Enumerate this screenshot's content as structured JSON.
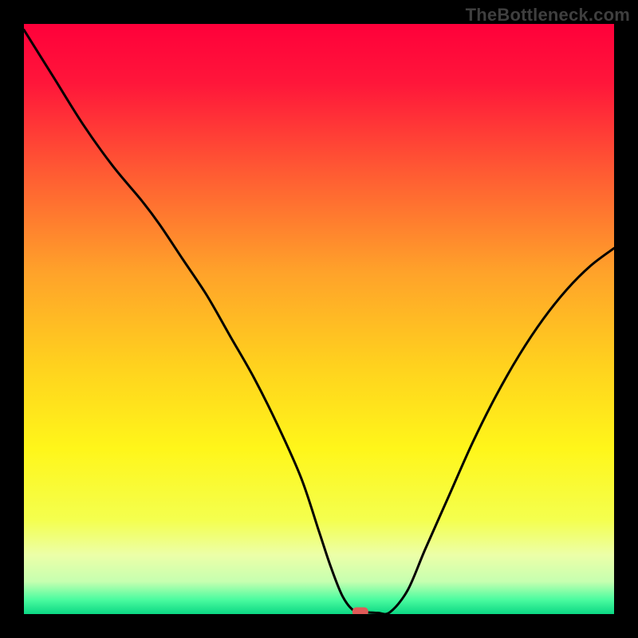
{
  "watermark": "TheBottleneck.com",
  "chart_data": {
    "type": "line",
    "title": "",
    "xlabel": "",
    "ylabel": "",
    "x_range": [
      0,
      100
    ],
    "y_range": [
      0,
      100
    ],
    "gradient_stops": [
      {
        "offset": 0.0,
        "color": "#ff003a"
      },
      {
        "offset": 0.1,
        "color": "#ff163a"
      },
      {
        "offset": 0.25,
        "color": "#ff5a33"
      },
      {
        "offset": 0.42,
        "color": "#ffa22a"
      },
      {
        "offset": 0.58,
        "color": "#ffd21e"
      },
      {
        "offset": 0.72,
        "color": "#fff61a"
      },
      {
        "offset": 0.84,
        "color": "#f4ff4e"
      },
      {
        "offset": 0.9,
        "color": "#ecffa8"
      },
      {
        "offset": 0.945,
        "color": "#c6ffb0"
      },
      {
        "offset": 0.975,
        "color": "#4dfca0"
      },
      {
        "offset": 1.0,
        "color": "#0bd884"
      }
    ],
    "series": [
      {
        "name": "bottleneck-curve",
        "x": [
          0,
          5,
          10,
          15,
          20,
          23,
          27,
          31,
          35,
          39,
          43,
          47,
          50,
          52,
          54,
          56,
          58,
          60,
          62,
          65,
          68,
          72,
          76,
          80,
          84,
          88,
          92,
          96,
          100
        ],
        "y": [
          99,
          91,
          83,
          76,
          70,
          66,
          60,
          54,
          47,
          40,
          32,
          23,
          14,
          8,
          3,
          0.5,
          0.3,
          0.2,
          0.3,
          4,
          11,
          20,
          29,
          37,
          44,
          50,
          55,
          59,
          62
        ]
      }
    ],
    "marker": {
      "x": 57,
      "y": 0.4,
      "color": "#e05a58"
    }
  }
}
